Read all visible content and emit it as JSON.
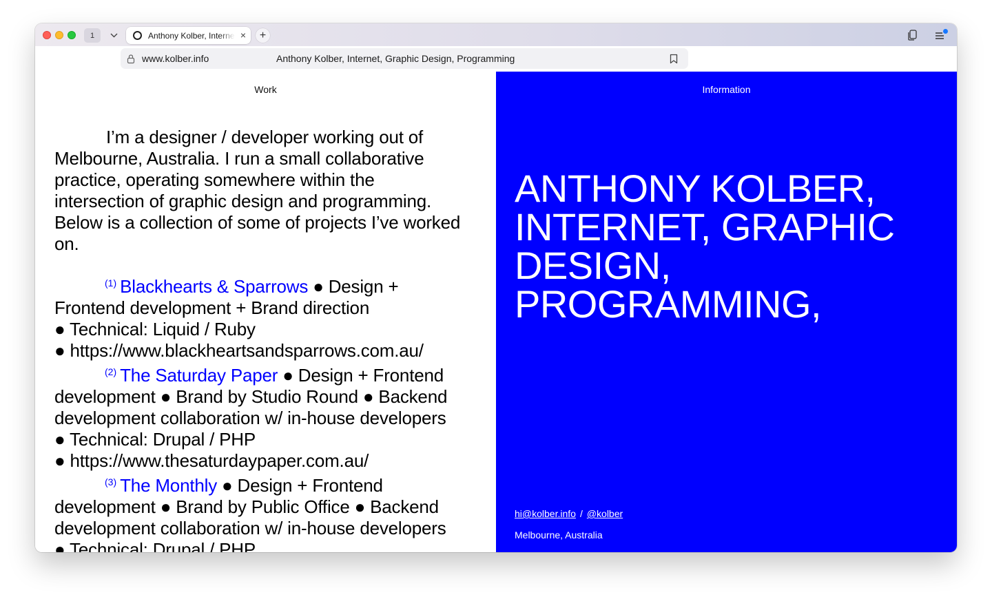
{
  "browser": {
    "tab_count": "1",
    "tab_title": "Anthony Kolber, Internet, Graphic Design, Programming",
    "tab_close": "×",
    "new_tab": "+",
    "url": "www.kolber.info",
    "omnibox_title": "Anthony Kolber, Internet, Graphic Design, Programming"
  },
  "nav": {
    "work": "Work",
    "information": "Information"
  },
  "intro": "I’m a designer / developer working out of Melbourne, Australia. I run a small collaborative practice, operating somewhere within the intersection of graphic design and programming. Below is a collection of some of projects I’ve worked on.",
  "projects": [
    {
      "num": "(1)",
      "name": "Blackhearts & Sparrows",
      "details": " ● Design + Frontend development + Brand direction",
      "technical": "● Technical: Liquid / Ruby",
      "url": "● https://www.blackheartsandsparrows.com.au/"
    },
    {
      "num": "(2)",
      "name": "The Saturday Paper",
      "details": " ● Design + Frontend development ● Brand by Studio Round ● Backend development collaboration w/ in-house developers",
      "technical": "● Technical: Drupal / PHP",
      "url": "● https://www.thesaturdaypaper.com.au/"
    },
    {
      "num": "(3)",
      "name": "The Monthly",
      "details": " ● Design + Frontend development ● Brand by Public Office ● Backend development collaboration w/ in-house developers",
      "technical": "● Technical: Drupal / PHP",
      "url": ""
    }
  ],
  "headline": "Anthony Kolber, Internet, Graphic Design, Programming,",
  "contact": {
    "email": "hi@kolber.info",
    "separator": "/",
    "handle": "@kolber",
    "location": "Melbourne, Australia"
  },
  "colors": {
    "accent_blue": "#0000ff",
    "text": "#000000",
    "background": "#ffffff"
  }
}
